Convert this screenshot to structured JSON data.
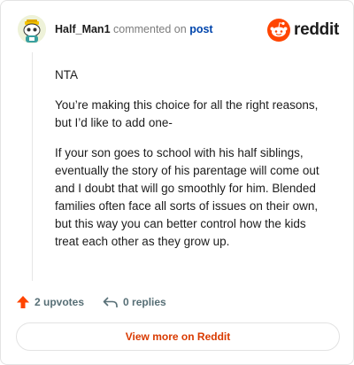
{
  "comment": {
    "username": "Half_Man1",
    "action_text": "commented on",
    "post_link": "post",
    "paragraphs": [
      "NTA",
      "You’re making this choice for all the right reasons, but I’d like to add one-",
      "If your son goes to school with his half siblings, eventually the story of his parentage will come out and I doubt that will go smoothly for him. Blended families often face all sorts of issues on their own, but this way you can better control how the kids treat each other as they grow up."
    ]
  },
  "brand": {
    "wordmark": "reddit",
    "accent": "#ff4500"
  },
  "footer": {
    "upvotes_label": "2 upvotes",
    "replies_label": "0 replies",
    "view_more_label": "View more on Reddit",
    "view_more_color": "#d93a00"
  },
  "icons": {
    "avatar": "snoo-avatar-icon",
    "logo": "reddit-snoo-icon",
    "upvote": "upvote-arrow-icon",
    "reply": "reply-arrow-icon"
  }
}
